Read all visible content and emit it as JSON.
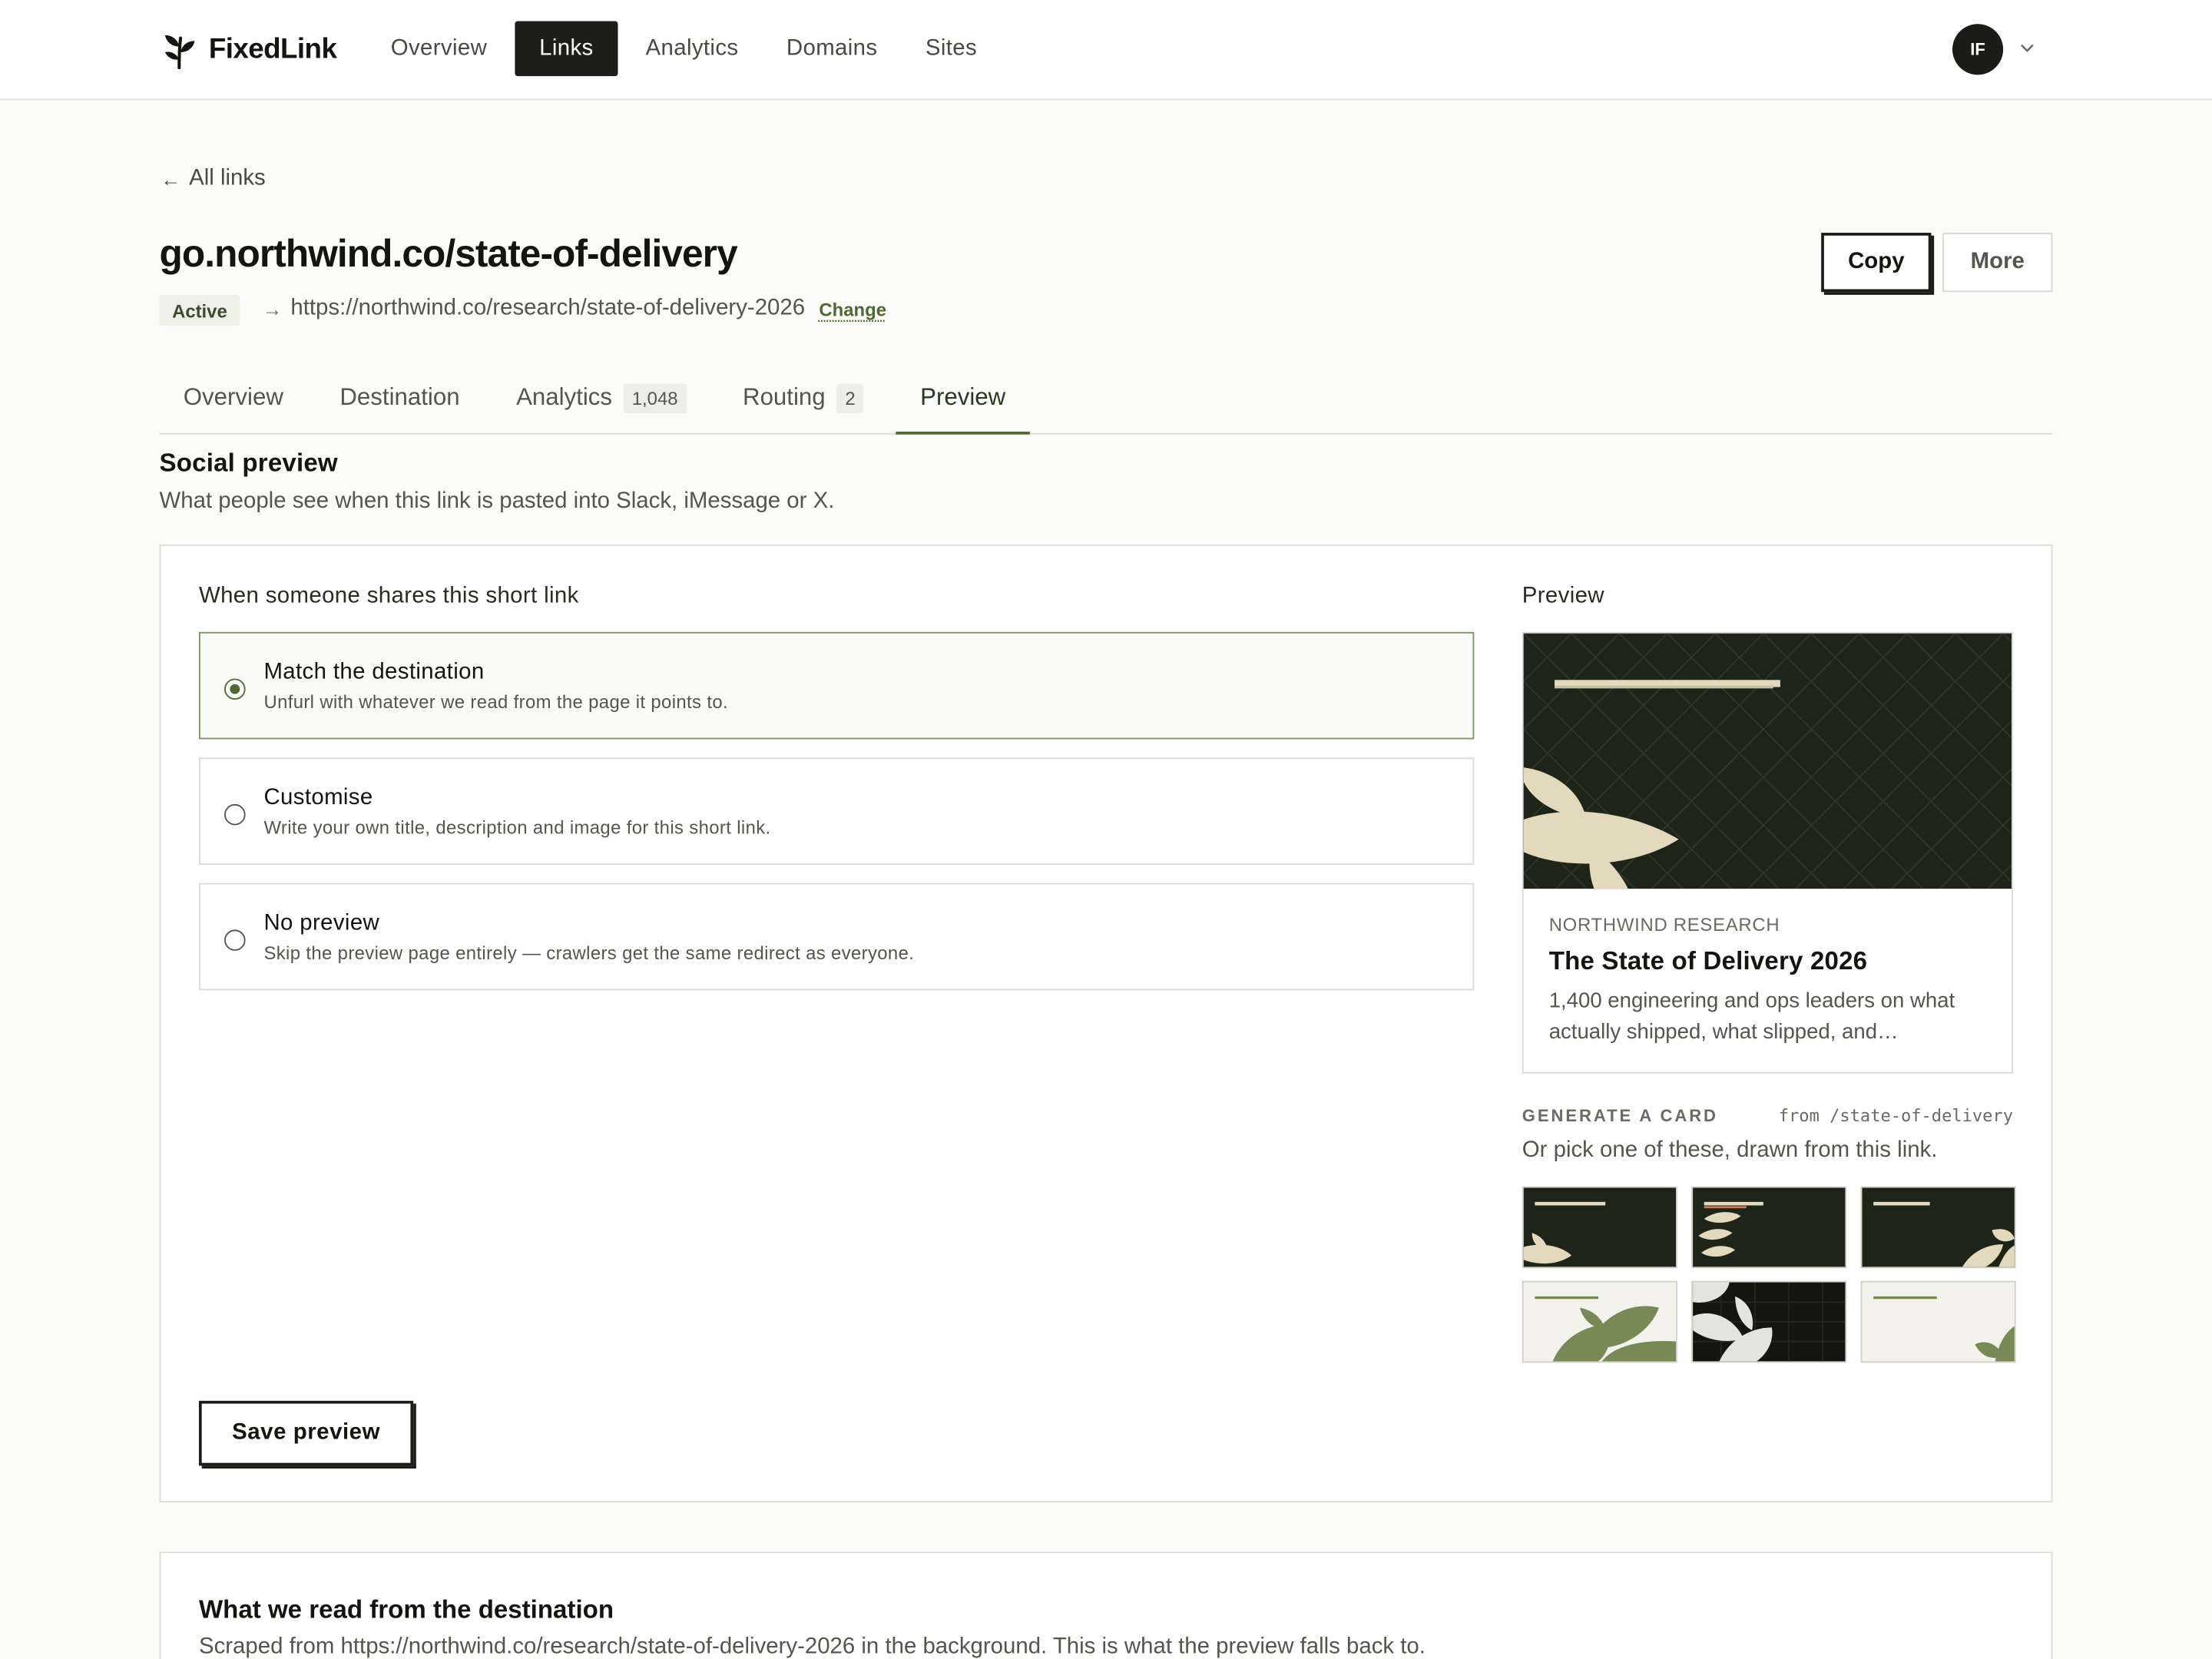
{
  "nav": {
    "brand": "FixedLink",
    "items": [
      {
        "label": "Overview",
        "active": false
      },
      {
        "label": "Links",
        "active": true
      },
      {
        "label": "Analytics",
        "active": false
      },
      {
        "label": "Domains",
        "active": false
      },
      {
        "label": "Sites",
        "active": false
      }
    ],
    "avatar_initials": "IF"
  },
  "header": {
    "back_label": "All links",
    "title": "go.northwind.co/state-of-delivery",
    "status": "Active",
    "destination": "https://northwind.co/research/state-of-delivery-2026",
    "change_label": "Change",
    "copy_label": "Copy",
    "more_label": "More"
  },
  "tabs": [
    {
      "label": "Overview",
      "count": null,
      "active": false
    },
    {
      "label": "Destination",
      "count": null,
      "active": false
    },
    {
      "label": "Analytics",
      "count": "1,048",
      "active": false
    },
    {
      "label": "Routing",
      "count": "2",
      "active": false
    },
    {
      "label": "Preview",
      "count": null,
      "active": true
    }
  ],
  "social": {
    "title": "Social preview",
    "subtitle": "What people see when this link is pasted into Slack, iMessage or X.",
    "options_label": "When someone shares this short link",
    "options": [
      {
        "title": "Match the destination",
        "desc": "Unfurl with whatever we read from the page it points to.",
        "selected": true
      },
      {
        "title": "Customise",
        "desc": "Write your own title, description and image for this short link.",
        "selected": false
      },
      {
        "title": "No preview",
        "desc": "Skip the preview page entirely — crawlers get the same redirect as everyone.",
        "selected": false
      }
    ],
    "save_label": "Save preview"
  },
  "preview": {
    "label": "Preview",
    "site": "NORTHWIND RESEARCH",
    "title": "The State of Delivery 2026",
    "description": "1,400 engineering and ops leaders on what actually shipped, what slipped, and…",
    "generate_label": "GENERATE A CARD",
    "generate_from": "from /state-of-delivery",
    "generate_sub": "Or pick one of these, drawn from this link."
  },
  "scraped": {
    "title": "What we read from the destination",
    "subtitle": "Scraped from https://northwind.co/research/state-of-delivery-2026 in the background. This is what the preview falls back to."
  },
  "colors": {
    "accent": "#4c6a32",
    "dark_bg": "#1f2419",
    "leaf_cream": "#e3d9bd",
    "leaf_olive": "#778a55"
  },
  "icons": {
    "brand": "leaf-sprig-icon",
    "avatar_menu": "chevron-down-icon",
    "back": "arrow-left-icon",
    "destination": "arrow-right-icon"
  }
}
